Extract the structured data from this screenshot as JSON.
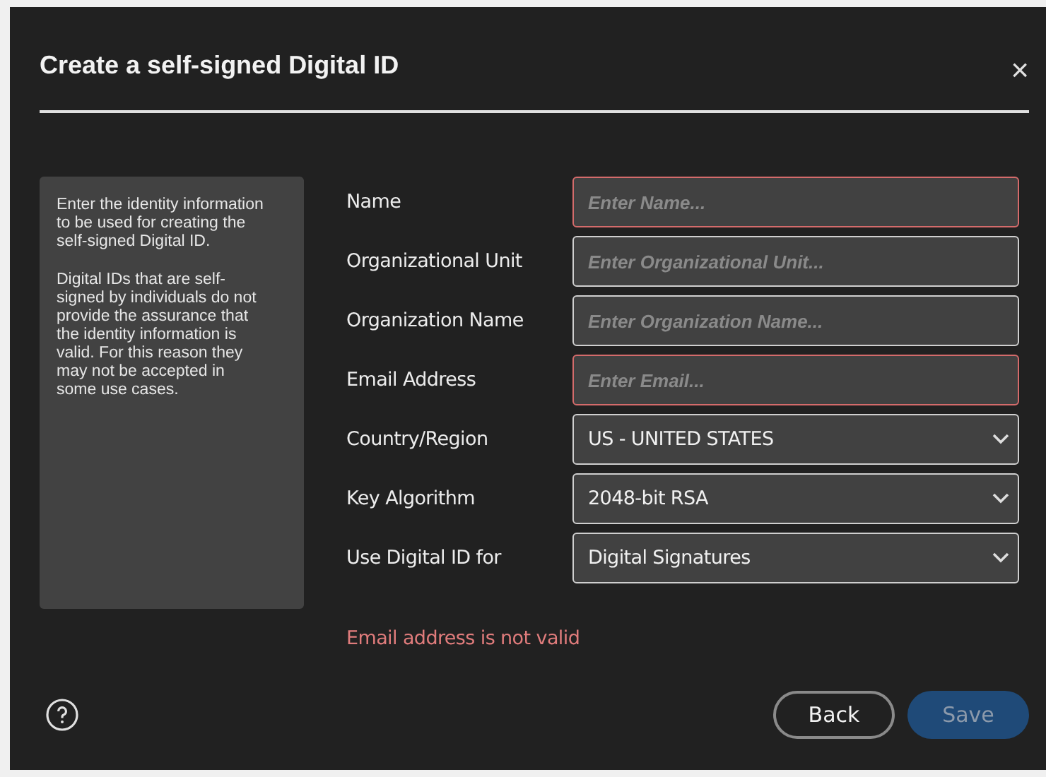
{
  "dialog": {
    "title": "Create a self-signed Digital ID",
    "close": "×"
  },
  "info_panel": {
    "paragraphs": [
      "Enter the identity information to be used for creating the self-signed Digital ID.",
      "Digital IDs that are self-signed by individuals do not provide the assurance that the identity information is valid. For this reason they may not be accepted in some use cases."
    ]
  },
  "fields": [
    {
      "kind": "text",
      "label": "Name",
      "placeholder": "Enter Name...",
      "invalid": true
    },
    {
      "kind": "text",
      "label": "Organizational Unit",
      "placeholder": "Enter Organizational Unit...",
      "invalid": false
    },
    {
      "kind": "text",
      "label": "Organization Name",
      "placeholder": "Enter Organization Name...",
      "invalid": false
    },
    {
      "kind": "text",
      "label": "Email Address",
      "placeholder": "Enter Email...",
      "invalid": true
    },
    {
      "kind": "select",
      "label": "Country/Region",
      "value": "US - UNITED STATES"
    },
    {
      "kind": "select",
      "label": "Key Algorithm",
      "value": "2048-bit RSA"
    },
    {
      "kind": "select",
      "label": "Use Digital ID for",
      "value": "Digital Signatures"
    }
  ],
  "error": "Email address is not valid",
  "buttons": [
    {
      "label": "Back",
      "kind": "secondary",
      "disabled": false
    },
    {
      "label": "Save",
      "kind": "primary",
      "disabled": true
    }
  ]
}
